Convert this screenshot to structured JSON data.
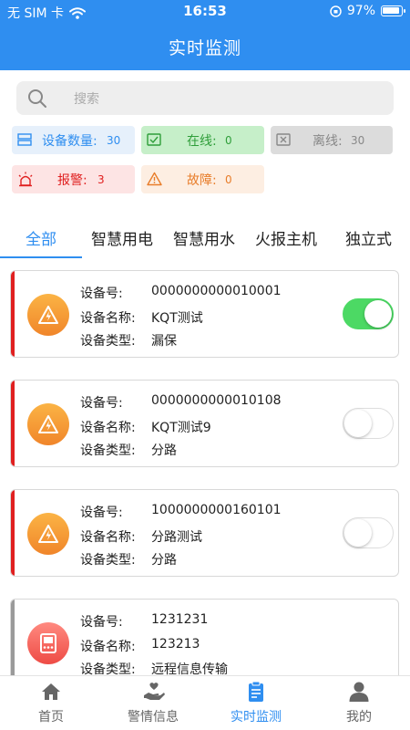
{
  "status_bar": {
    "carrier": "无 SIM 卡",
    "time": "16:53",
    "battery": "97%"
  },
  "header": {
    "title": "实时监测"
  },
  "search": {
    "placeholder": "搜索"
  },
  "stats": {
    "device_count": {
      "label": "设备数量:",
      "value": "30"
    },
    "online": {
      "label": "在线:",
      "value": "0"
    },
    "offline": {
      "label": "离线:",
      "value": "30"
    },
    "alarm": {
      "label": "报警:",
      "value": "3"
    },
    "fault": {
      "label": "故障:",
      "value": "0"
    }
  },
  "tabs": [
    "全部",
    "智慧用电",
    "智慧用水",
    "火报主机",
    "独立式"
  ],
  "device_labels": {
    "id": "设备号:",
    "name": "设备名称:",
    "type": "设备类型:"
  },
  "devices": [
    {
      "id": "0000000000010001",
      "name": "KQT测试",
      "type": "漏保",
      "switch_on": true,
      "bar_color": "#e02020"
    },
    {
      "id": "0000000000010108",
      "name": "KQT测试9",
      "type": "分路",
      "switch_on": false,
      "bar_color": "#e02020"
    },
    {
      "id": "1000000000160101",
      "name": "分路测试",
      "type": "分路",
      "switch_on": false,
      "bar_color": "#e02020"
    },
    {
      "id": "1231231",
      "name": "123213",
      "type": "远程信息传输",
      "switch_on": false,
      "bar_color": "#9a9a9a"
    }
  ],
  "bottom_nav": [
    "首页",
    "警情信息",
    "实时监测",
    "我的"
  ],
  "colors": {
    "primary": "#2f8ef0",
    "online_green": "#4cd964",
    "alarm_red": "#e02020",
    "fault_orange": "#e87d2a"
  }
}
